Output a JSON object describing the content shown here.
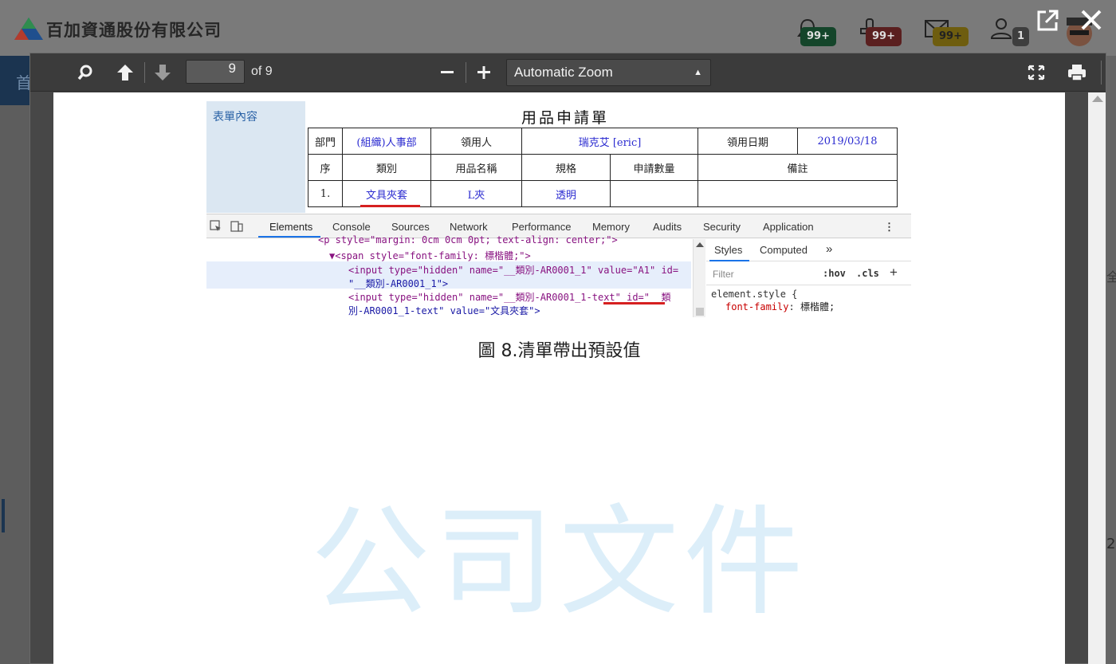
{
  "app": {
    "company_name": "百加資通股份有限公司",
    "badges": {
      "bell": "99+",
      "stamp": "99+",
      "mail": "99+",
      "user": "1"
    },
    "bg_nav_char": "首",
    "bg_right_char": "全",
    "bg_right_digit": "2"
  },
  "viewer": {
    "page_number": "9",
    "page_total": "of 9",
    "zoom": "Automatic Zoom",
    "caption": "圖 8.清單帶出預設值",
    "watermark": "公司文件"
  },
  "figure": {
    "left_label": "表單內容",
    "form_title": "用品申請單",
    "row1": [
      "部門",
      "(組織)人事部",
      "領用人",
      "瑞克艾 [eric]",
      "領用日期",
      "2019/03/18"
    ],
    "header_row": [
      "序",
      "類別",
      "用品名稱",
      "規格",
      "申請數量",
      "備註"
    ],
    "data_row": [
      "1.",
      "文具夾套",
      "L夾",
      "透明",
      "",
      ""
    ],
    "devtools": {
      "tabs": [
        "Elements",
        "Console",
        "Sources",
        "Network",
        "Performance",
        "Memory",
        "Audits",
        "Security",
        "Application"
      ],
      "dom_lines": [
        "<p style=\"margin: 0cm 0cm 0pt; text-align: center;\">",
        "▼<span style=\"font-family: 標楷體;\">",
        "<input type=\"hidden\" name=\"__類別-AR0001_1\" value=\"A1\" id=",
        "\"__類別-AR0001_1\">",
        "<input type=\"hidden\" name=\"__類別-AR0001_1-text\" id=\"__類",
        "別-AR0001_1-text\" value=\"文具夾套\">"
      ],
      "styles_tabs": [
        "Styles",
        "Computed",
        "»"
      ],
      "filter_placeholder": "Filter",
      "filter_tools": [
        ":hov",
        ".cls",
        "+"
      ],
      "rule_selector": "element.style {",
      "rule_prop": "font-family",
      "rule_value": "標楷體;"
    }
  },
  "colors": {
    "badge_green": "#14452a",
    "badge_red": "#5a1f1f",
    "badge_yellow": "#6e5d0f",
    "link_blue": "#2b2bd0",
    "underline_red": "#d62020",
    "watermark": "#d6ecf8"
  }
}
